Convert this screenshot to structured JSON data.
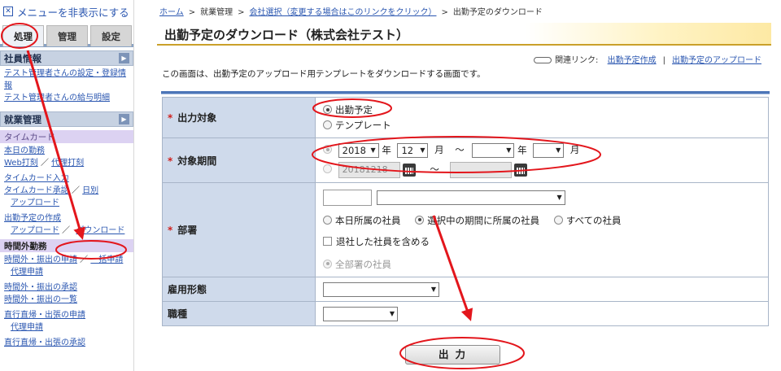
{
  "sidebar": {
    "toggle_label": "メニューを非表示にする",
    "tabs": [
      {
        "label": "処理",
        "active": true
      },
      {
        "label": "管理",
        "active": false
      },
      {
        "label": "設定",
        "active": false
      }
    ],
    "section_employee": "社員情報",
    "employee_links": [
      "テスト管理者さんの設定・登録情報",
      "テスト管理者さんの給与明細"
    ],
    "section_work": "就業管理",
    "timecard_head": "タイムカード",
    "today_work": "本日の勤務",
    "web_punch": "Web打刻",
    "proxy_punch": "代理打刻",
    "timecard_input": "タイムカード入力",
    "timecard_approval": "タイムカード承認",
    "by_day": "日別",
    "upload1": "アップロード",
    "schedule_create": "出勤予定の作成",
    "upload2": "アップロード",
    "download": "ダウンロード",
    "overtime_head": "時間外勤務",
    "ot_apply": "時間外・振出の申請",
    "ot_bulk": "一括申請",
    "ot_proxy": "代理申請",
    "ot_approve": "時間外・振出の承認",
    "ot_list": "時間外・振出の一覧",
    "direct_apply": "直行直帰・出張の申請",
    "direct_proxy": "代理申請",
    "direct_approve": "直行直帰・出張の承認"
  },
  "breadcrumb": {
    "home": "ホーム",
    "work": "就業管理",
    "company": "会社選択（変更する場合はこのリンクをクリック）",
    "current": "出勤予定のダウンロード",
    "separator": ">"
  },
  "page_title": "出勤予定のダウンロード（株式会社テスト）",
  "related": {
    "label": "関連リンク:",
    "link1": "出勤予定作成",
    "separator": "|",
    "link2": "出勤予定のアップロード"
  },
  "description": "この画面は、出勤予定のアップロード用テンプレートをダウンロードする画面です。",
  "form": {
    "req_mark": "*",
    "output_label": "出力対象",
    "output_options": [
      {
        "label": "出勤予定",
        "selected": true
      },
      {
        "label": "テンプレート",
        "selected": false
      }
    ],
    "period_label": "対象期間",
    "year": "2018",
    "year_unit": "年",
    "month": "12",
    "month_unit": "月",
    "tilde": "〜",
    "year_to": "",
    "month_to": "",
    "date_from": "20181218",
    "date_to": "",
    "dept_label": "部署",
    "dept_code": "",
    "dept_select": "",
    "dept_scope": [
      {
        "label": "本日所属の社員",
        "selected": false
      },
      {
        "label": "選択中の期間に所属の社員",
        "selected": true
      },
      {
        "label": "すべての社員",
        "selected": false
      }
    ],
    "include_retired": "退社した社員を含める",
    "all_depts": "全部署の社員",
    "employment_label": "雇用形態",
    "employment_value": "",
    "job_label": "職種",
    "job_value": ""
  },
  "output_button": "出力",
  "annotation_color": "#e3161c"
}
